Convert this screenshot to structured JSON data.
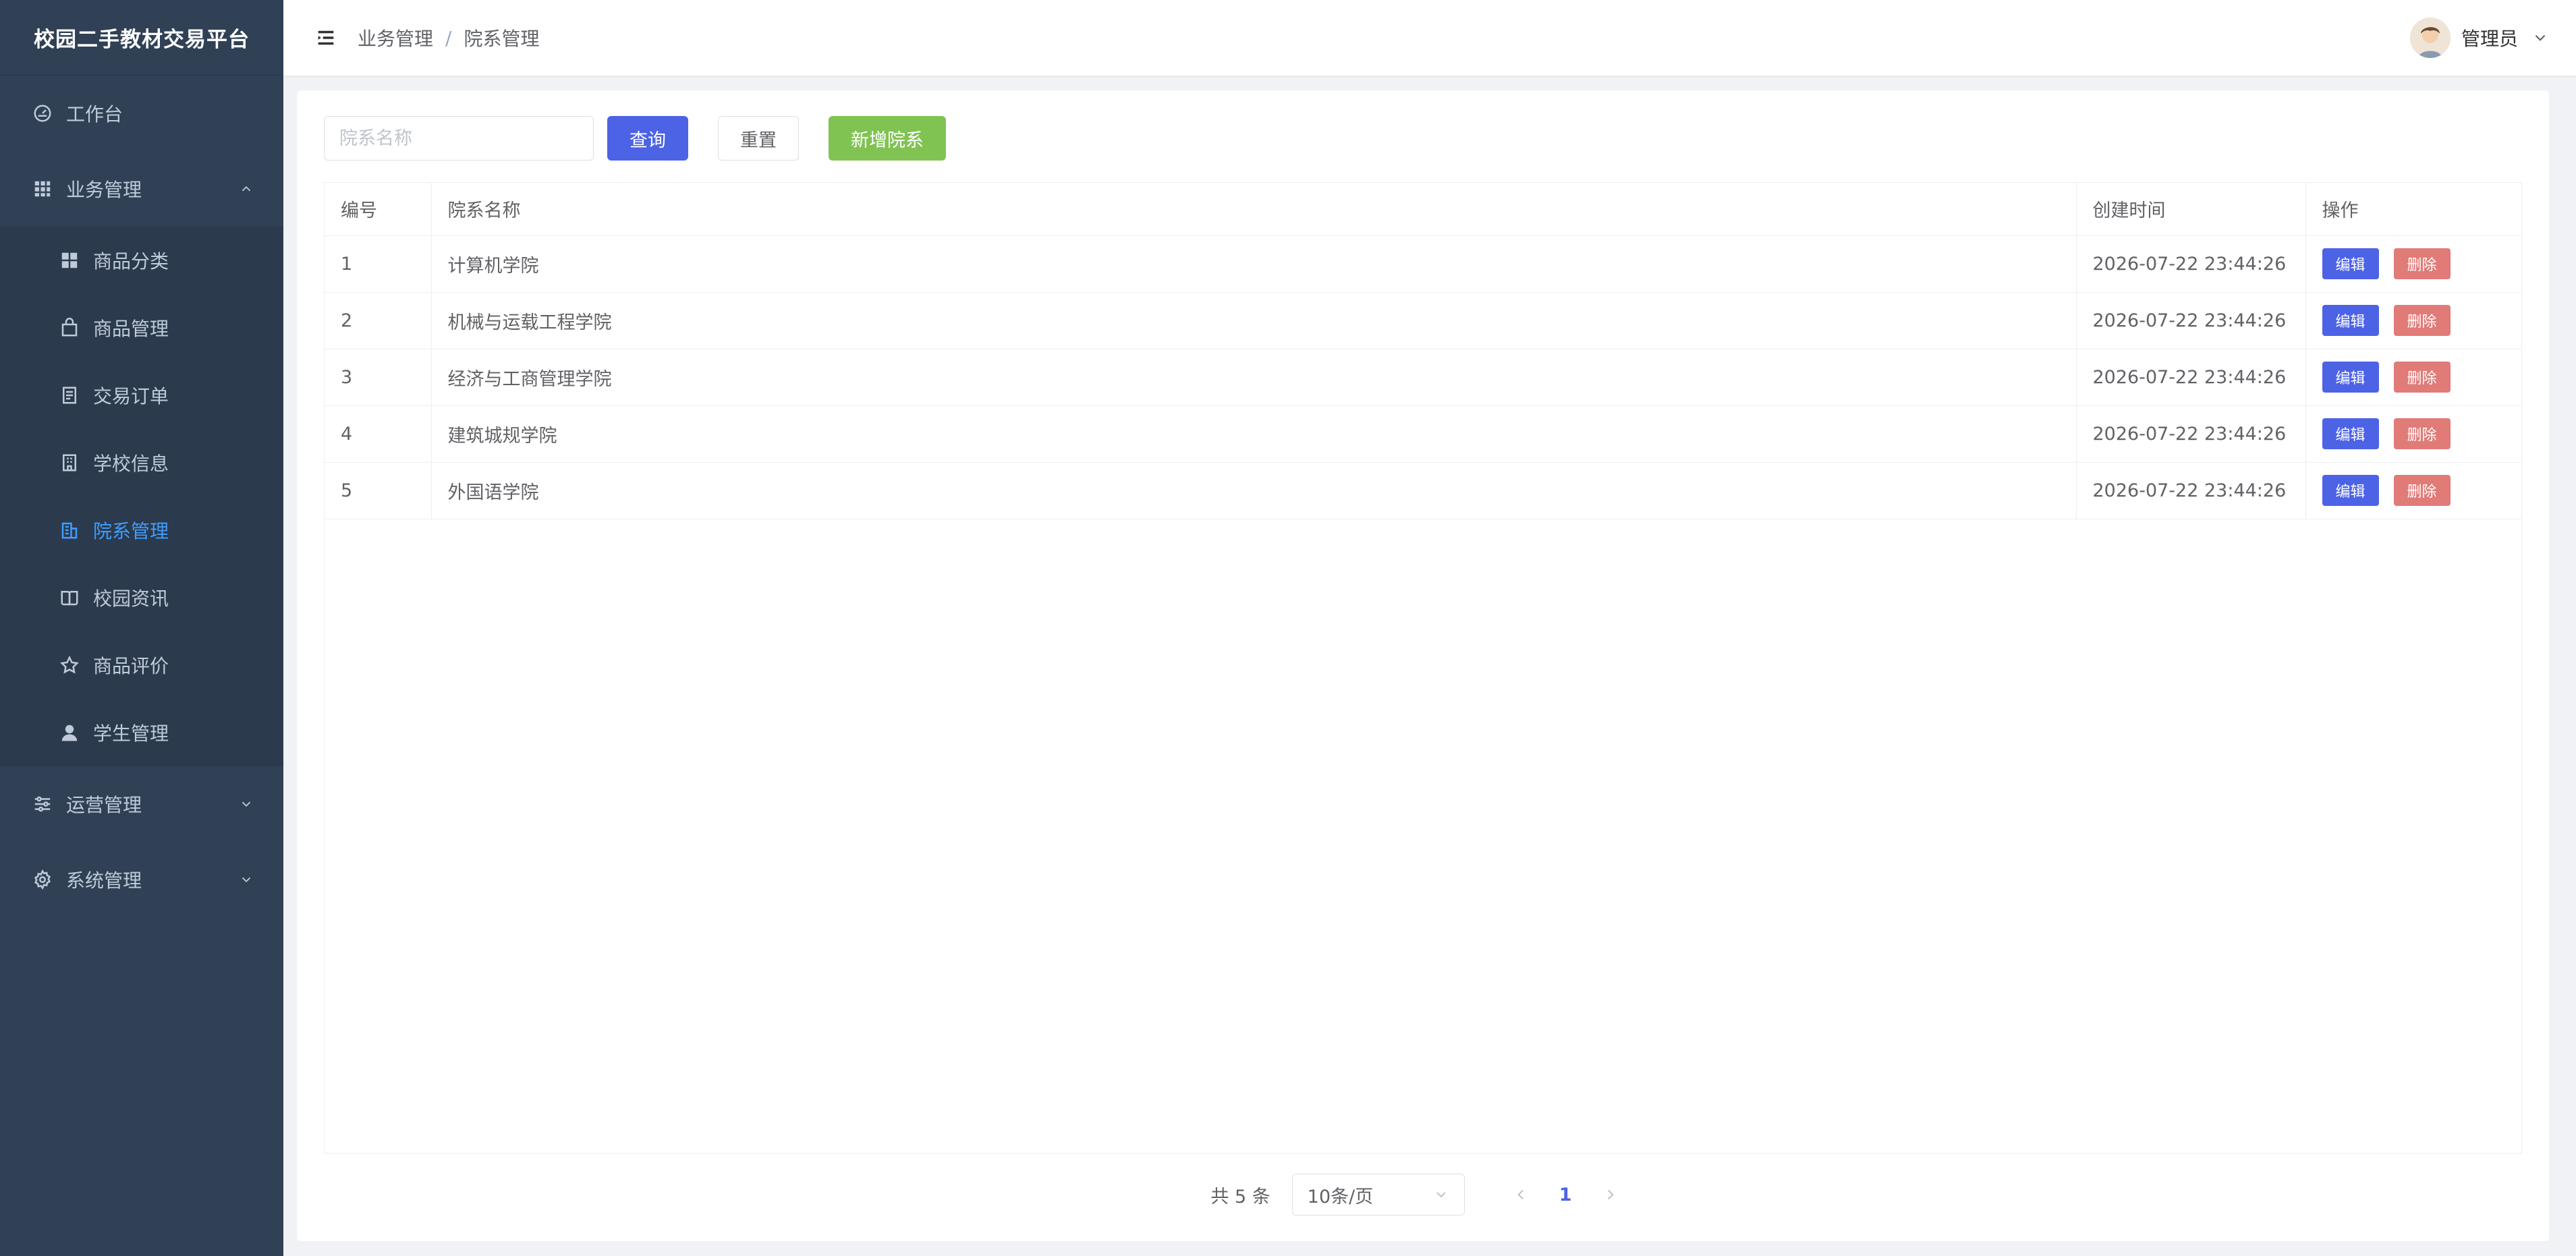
{
  "brand": {
    "title": "校园二手教材交易平台"
  },
  "sidebar": {
    "items": [
      {
        "label": "工作台",
        "icon": "dashboard-icon"
      },
      {
        "label": "业务管理",
        "icon": "grid-icon",
        "expanded": true,
        "children": [
          {
            "label": "商品分类",
            "icon": "category-icon"
          },
          {
            "label": "商品管理",
            "icon": "bag-icon"
          },
          {
            "label": "交易订单",
            "icon": "document-icon"
          },
          {
            "label": "学校信息",
            "icon": "school-icon"
          },
          {
            "label": "院系管理",
            "icon": "building-icon",
            "active": true
          },
          {
            "label": "校园资讯",
            "icon": "book-icon"
          },
          {
            "label": "商品评价",
            "icon": "star-icon"
          },
          {
            "label": "学生管理",
            "icon": "user-icon"
          }
        ]
      },
      {
        "label": "运营管理",
        "icon": "sliders-icon",
        "expanded": false
      },
      {
        "label": "系统管理",
        "icon": "gear-icon",
        "expanded": false
      }
    ]
  },
  "header": {
    "breadcrumb": [
      "业务管理",
      "院系管理"
    ],
    "breadcrumb_sep": "/",
    "user_name": "管理员"
  },
  "toolbar": {
    "search_placeholder": "院系名称",
    "search_value": "",
    "query_label": "查询",
    "reset_label": "重置",
    "add_label": "新增院系"
  },
  "table": {
    "columns": [
      "编号",
      "院系名称",
      "创建时间",
      "操作"
    ],
    "edit_label": "编辑",
    "delete_label": "删除",
    "rows": [
      {
        "id": "1",
        "name": "计算机学院",
        "created": "2026-07-22 23:44:26"
      },
      {
        "id": "2",
        "name": "机械与运载工程学院",
        "created": "2026-07-22 23:44:26"
      },
      {
        "id": "3",
        "name": "经济与工商管理学院",
        "created": "2026-07-22 23:44:26"
      },
      {
        "id": "4",
        "name": "建筑城规学院",
        "created": "2026-07-22 23:44:26"
      },
      {
        "id": "5",
        "name": "外国语学院",
        "created": "2026-07-22 23:44:26"
      }
    ]
  },
  "pagination": {
    "total_text": "共 5 条",
    "page_size": "10条/页",
    "current_page": "1"
  },
  "colors": {
    "sidebar_bg": "#304156",
    "sidebar_text": "#bfcbd9",
    "active": "#409eff",
    "primary": "#4c63e6",
    "success": "#80c353",
    "danger": "#e07b78"
  }
}
